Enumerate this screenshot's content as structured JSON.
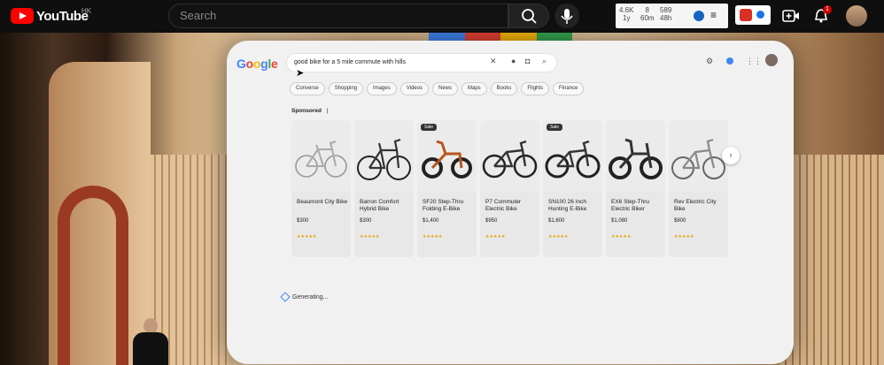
{
  "youtube": {
    "logo_text": "YouTube",
    "region": "HK",
    "search_placeholder": "Search",
    "ext_stats": [
      {
        "top": "4.6K",
        "bottom": "1y"
      },
      {
        "top": "8",
        "bottom": "60m"
      },
      {
        "top": "589",
        "bottom": "48h"
      }
    ],
    "notification_count": "1"
  },
  "google": {
    "logo": "Google",
    "query": "good bike for a 5 mile commute with hills",
    "chips": [
      "Converse",
      "Shopping",
      "Images",
      "Videos",
      "News",
      "Maps",
      "Books",
      "Flights",
      "Finance"
    ],
    "sponsored_label": "Sponsored",
    "sponsored_sep": "|",
    "next_label": "›",
    "generating": "Generating...",
    "products": [
      {
        "name": "Beaumont City Bike",
        "price": "$300",
        "sale": ""
      },
      {
        "name": "Barron Comfort Hybrid Bike",
        "price": "$300",
        "sale": ""
      },
      {
        "name": "SF20 Step-Thru Folding E-Bike",
        "price": "$1,400",
        "sale": "Sale"
      },
      {
        "name": "P7 Commuter Electric Bike",
        "price": "$950",
        "sale": ""
      },
      {
        "name": "SN100 26 Inch Hunting E-Bike",
        "price": "$1,600",
        "sale": "Sale"
      },
      {
        "name": "EX6 Step-Thru Electric Biker",
        "price": "$1,080",
        "sale": ""
      },
      {
        "name": "Rev Electric City Bike",
        "price": "$800",
        "sale": ""
      }
    ]
  },
  "colors": {
    "youtube_red": "#ff0000",
    "google_blue": "#4285f4",
    "google_red": "#ea4335",
    "google_yellow": "#fbbc05",
    "google_green": "#34a853"
  }
}
